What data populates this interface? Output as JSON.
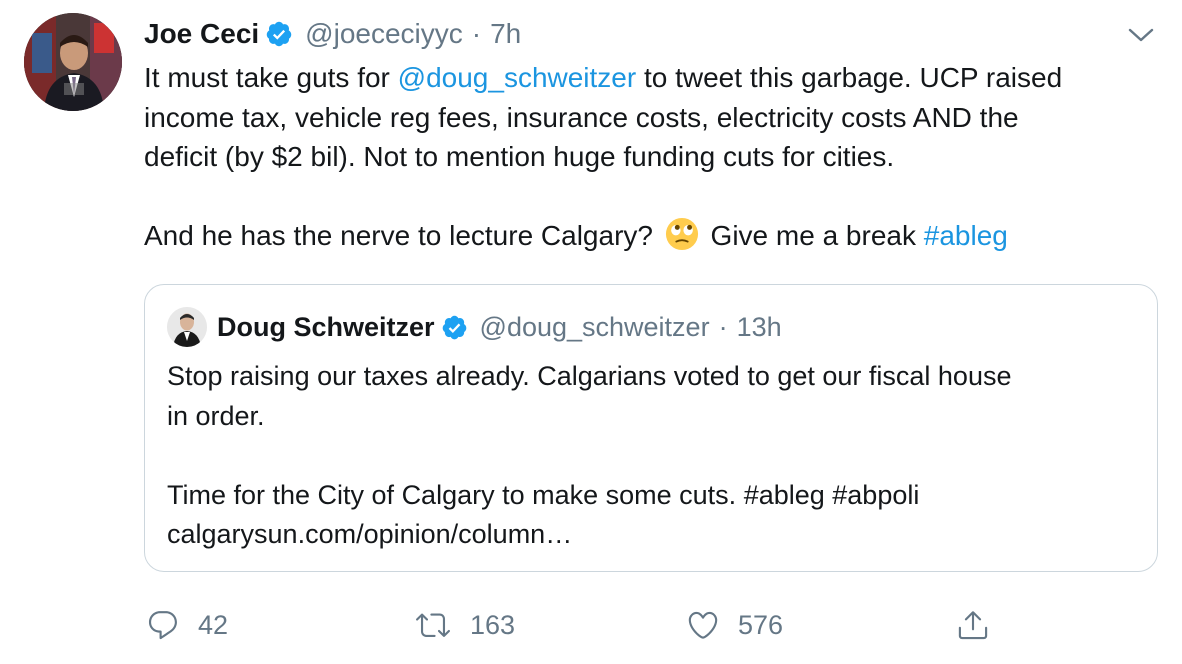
{
  "tweet": {
    "author_name": "Joe Ceci",
    "handle": "@joececiyyc",
    "separator": "·",
    "time": "7h",
    "line1_pre": "It must take guts for ",
    "mention": "@doug_schweitzer",
    "line1_post": " to tweet this garbage. UCP raised",
    "line2": "income tax, vehicle reg fees, insurance costs, electricity costs AND the",
    "line3": "deficit (by $2 bil). Not to mention huge funding cuts for cities.",
    "line4_pre": "And he has the nerve to lecture Calgary?",
    "emoji": "face-with-rolling-eyes",
    "line4_post": "Give me a break ",
    "hashtag": "#ableg"
  },
  "quoted_tweet": {
    "author_name": "Doug Schweitzer",
    "handle": "@doug_schweitzer",
    "separator": "·",
    "time": "13h",
    "line1": "Stop raising our taxes already. Calgarians voted to get our fiscal house",
    "line2": "in order.",
    "line3": "Time for the City of Calgary to make some cuts. #ableg #abpoli",
    "line4": "calgarysun.com/opinion/column…"
  },
  "actions": {
    "replies": "42",
    "retweets": "163",
    "likes": "576"
  },
  "icons": {
    "verified": "verified-badge-icon",
    "menu": "chevron-down-icon",
    "reply": "reply-icon",
    "retweet": "retweet-icon",
    "like": "heart-icon",
    "share": "share-icon"
  },
  "colors": {
    "link": "#1b95e0",
    "verified": "#1da1f2",
    "muted": "#657786",
    "border": "#ccd6dd",
    "text": "#14171a"
  }
}
